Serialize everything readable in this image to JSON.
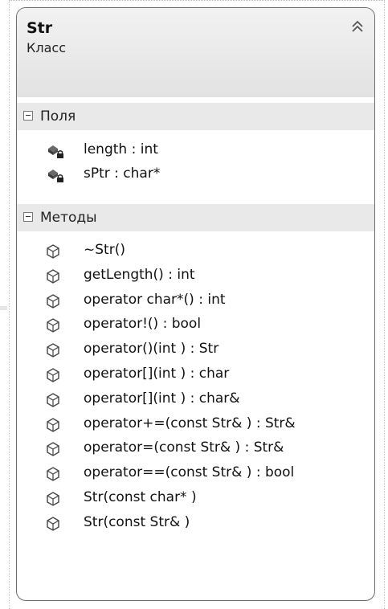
{
  "class": {
    "name": "Str",
    "kind": "Класс"
  },
  "collapse_icon": "double-chevron-up-icon",
  "fields_section": {
    "label": "Поля",
    "items": [
      {
        "label": "length : int",
        "icon": "private-field-icon"
      },
      {
        "label": "sPtr : char*",
        "icon": "private-field-icon"
      }
    ]
  },
  "methods_section": {
    "label": "Методы",
    "items": [
      {
        "label": "~Str()",
        "icon": "method-icon"
      },
      {
        "label": "getLength() : int",
        "icon": "method-icon"
      },
      {
        "label": "operator char*() : int",
        "icon": "method-icon"
      },
      {
        "label": "operator!() : bool",
        "icon": "method-icon"
      },
      {
        "label": "operator()(int ) : Str",
        "icon": "method-icon"
      },
      {
        "label": "operator[](int ) : char",
        "icon": "method-icon"
      },
      {
        "label": "operator[](int ) : char&",
        "icon": "method-icon"
      },
      {
        "label": "operator+=(const Str& ) : Str&",
        "icon": "method-icon"
      },
      {
        "label": "operator=(const Str& ) : Str&",
        "icon": "method-icon"
      },
      {
        "label": "operator==(const Str& ) : bool",
        "icon": "method-icon"
      },
      {
        "label": "Str(const char* )",
        "icon": "method-icon"
      },
      {
        "label": "Str(const Str& )",
        "icon": "method-icon"
      }
    ]
  }
}
